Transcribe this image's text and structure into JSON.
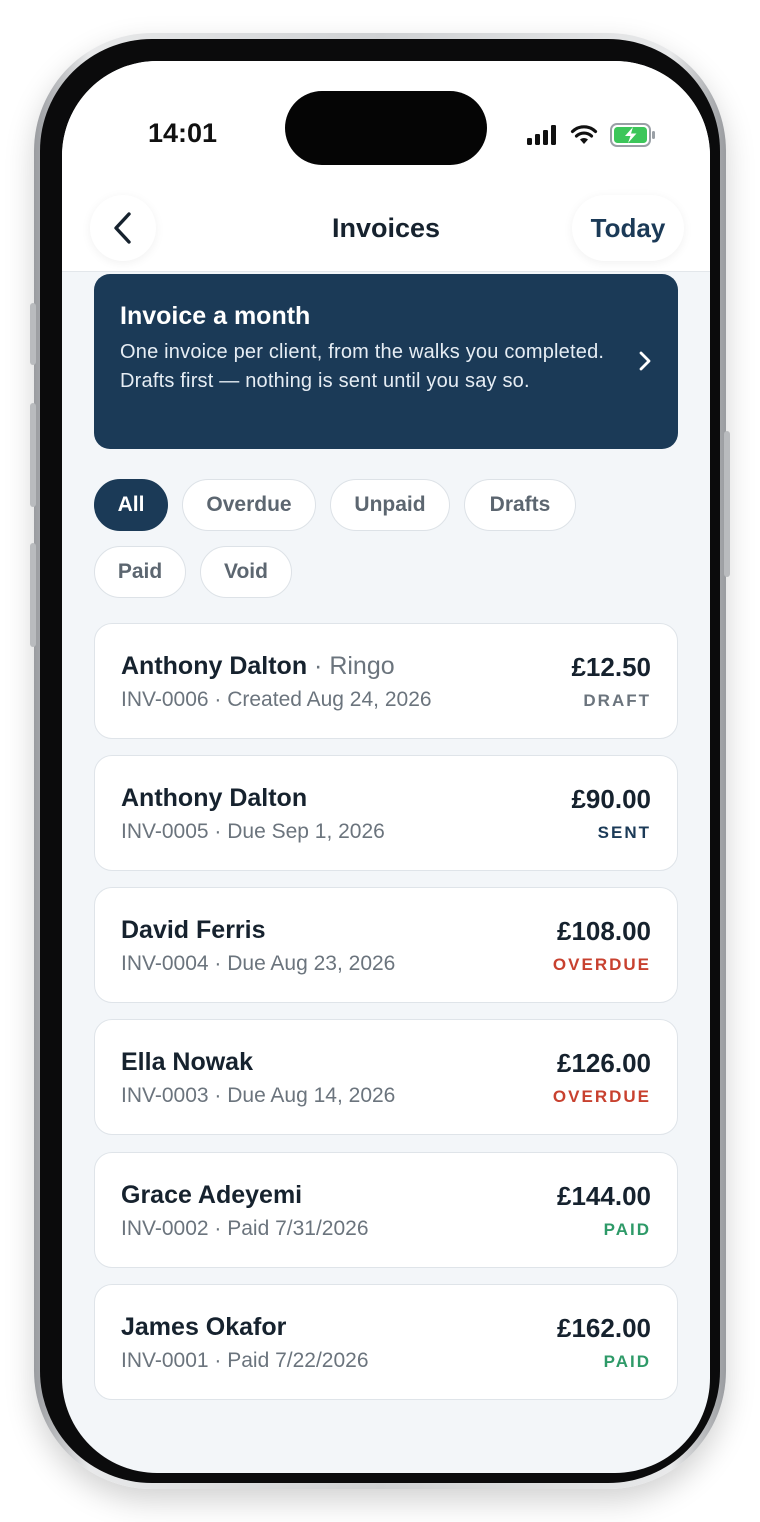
{
  "status_bar": {
    "time": "14:01"
  },
  "nav": {
    "title": "Invoices",
    "today_label": "Today"
  },
  "banner": {
    "title": "Invoice a month",
    "text": "One invoice per client, from the walks you completed. Drafts first — nothing is sent until you say so."
  },
  "filters": [
    "All",
    "Overdue",
    "Unpaid",
    "Drafts",
    "Paid",
    "Void"
  ],
  "active_filter": "All",
  "invoices": [
    {
      "client": "Anthony Dalton",
      "pet": "Ringo",
      "meta": "INV-0006 · Created Aug 24, 2026",
      "amount": "£12.50",
      "status": "DRAFT"
    },
    {
      "client": "Anthony Dalton",
      "pet": "",
      "meta": "INV-0005 · Due Sep 1, 2026",
      "amount": "£90.00",
      "status": "SENT"
    },
    {
      "client": "David Ferris",
      "pet": "",
      "meta": "INV-0004 · Due Aug 23, 2026",
      "amount": "£108.00",
      "status": "OVERDUE"
    },
    {
      "client": "Ella Nowak",
      "pet": "",
      "meta": "INV-0003 · Due Aug 14, 2026",
      "amount": "£126.00",
      "status": "OVERDUE"
    },
    {
      "client": "Grace Adeyemi",
      "pet": "",
      "meta": "INV-0002 · Paid 7/31/2026",
      "amount": "£144.00",
      "status": "PAID"
    },
    {
      "client": "James Okafor",
      "pet": "",
      "meta": "INV-0001 · Paid 7/22/2026",
      "amount": "£162.00",
      "status": "PAID"
    }
  ],
  "colors": {
    "primary": "#1b3a57",
    "overdue": "#c8412f",
    "paid": "#2e9a68",
    "muted": "#6b747d"
  },
  "icons": {
    "back": "chevron-left-icon",
    "banner": "chevron-right-icon",
    "signal": "cellular-signal-icon",
    "wifi": "wifi-icon",
    "battery": "battery-charging-icon"
  }
}
